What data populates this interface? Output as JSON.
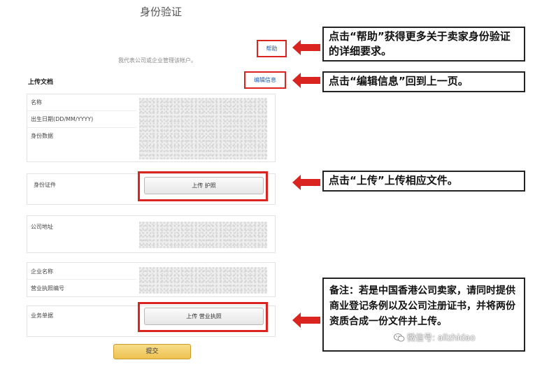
{
  "page": {
    "title": "身份验证",
    "subtitle": "我代表公司或企业管理该帐户。",
    "help_link": "帮助",
    "section_title": "上传文档",
    "edit_link": "编辑信息"
  },
  "identity_panel": {
    "labels": [
      "名称",
      "出生日期(DD/MM/YYYY)",
      "身份数据"
    ]
  },
  "id_document": {
    "label": "身份证件",
    "button": "上传 护照"
  },
  "company_address": {
    "label": "公司地址"
  },
  "company_info": {
    "labels": [
      "企业名称",
      "营业执照编号"
    ]
  },
  "business_doc": {
    "label": "业务单据",
    "button": "上传 营业执照"
  },
  "submit_button": "提交",
  "callouts": {
    "help": "点击“帮助”获得更多关于卖家身份验证的详细要求。",
    "edit": "点击“编辑信息”回到上一页。",
    "upload": "点击“上传”上传相应文件。",
    "note_prefix": "备注：若是中国香港公司卖家，请同时提供商业登记条例",
    "note_bold": "以及",
    "note_suffix": "公司注册证书，并将两份资质合成一份文件并上传。"
  },
  "watermark": "微信号: allzhidao",
  "colors": {
    "highlight_red": "#d9241f",
    "link_blue": "#1e5fb3",
    "submit_yellow": "#eec150"
  },
  "icons": [
    "red-arrow-icon",
    "wechat-icon"
  ]
}
